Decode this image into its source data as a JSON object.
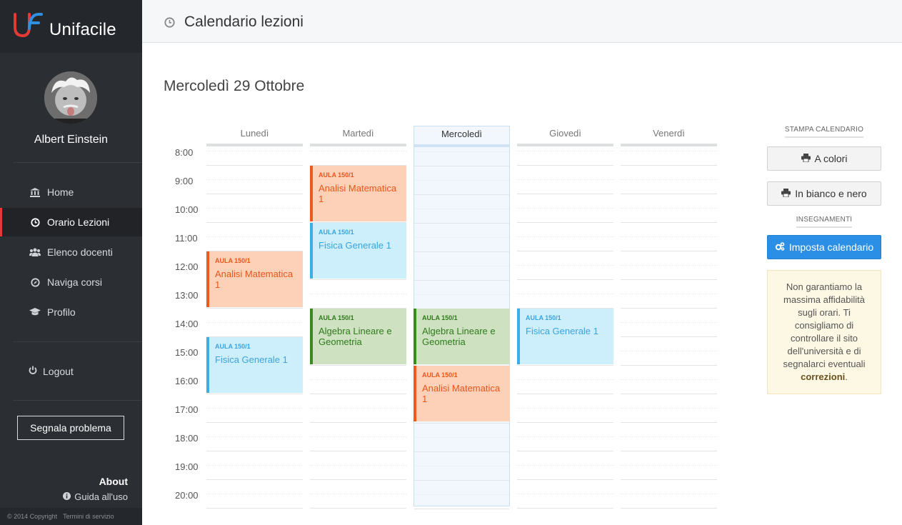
{
  "brand": {
    "name": "Unifacile"
  },
  "user": {
    "name": "Albert Einstein"
  },
  "nav": [
    {
      "label": "Home",
      "icon": "bank-icon"
    },
    {
      "label": "Orario Lezioni",
      "icon": "clock-icon",
      "active": true
    },
    {
      "label": "Elenco docenti",
      "icon": "users-icon"
    },
    {
      "label": "Naviga corsi",
      "icon": "compass-icon"
    },
    {
      "label": "Profilo",
      "icon": "graduation-cap-icon"
    }
  ],
  "logout_label": "Logout",
  "report_button": "Segnala problema",
  "about_label": "About",
  "guide_label": "Guida all'uso",
  "footer": {
    "copyright": "© 2014 Copyright",
    "terms": "Termini di servizio"
  },
  "header": {
    "title": "Calendario lezioni"
  },
  "date_title": "Mercoledì 29 Ottobre",
  "calendar": {
    "days": [
      "Lunedì",
      "Martedì",
      "Mercoledì",
      "Giovedì",
      "Venerdì"
    ],
    "today_index": 2,
    "hours": [
      "8:00",
      "9:00",
      "10:00",
      "11:00",
      "12:00",
      "13:00",
      "14:00",
      "15:00",
      "16:00",
      "17:00",
      "18:00",
      "19:00",
      "20:00"
    ],
    "events": [
      {
        "day": 0,
        "start": 11.5,
        "end": 13.5,
        "room": "AULA 150/1",
        "title": "Analisi Matematica 1",
        "color": "orange"
      },
      {
        "day": 0,
        "start": 14.5,
        "end": 16.5,
        "room": "AULA 150/1",
        "title": "Fisica Generale 1",
        "color": "blue"
      },
      {
        "day": 1,
        "start": 8.5,
        "end": 10.5,
        "room": "AULA 150/1",
        "title": "Analisi Matematica 1",
        "color": "orange"
      },
      {
        "day": 1,
        "start": 10.5,
        "end": 12.5,
        "room": "AULA 150/1",
        "title": "Fisica Generale 1",
        "color": "blue"
      },
      {
        "day": 1,
        "start": 13.5,
        "end": 15.5,
        "room": "AULA 150/1",
        "title": "Algebra Lineare e Geometria",
        "color": "green"
      },
      {
        "day": 2,
        "start": 13.5,
        "end": 15.5,
        "room": "AULA 150/1",
        "title": "Algebra Lineare e Geometria",
        "color": "green"
      },
      {
        "day": 2,
        "start": 15.5,
        "end": 17.5,
        "room": "AULA 150/1",
        "title": "Analisi Matematica 1",
        "color": "orange"
      },
      {
        "day": 3,
        "start": 13.5,
        "end": 15.5,
        "room": "AULA 150/1",
        "title": "Fisica Generale 1",
        "color": "blue"
      }
    ]
  },
  "panel": {
    "print_label": "STAMPA CALENDARIO",
    "color_button": "A colori",
    "bw_button": "In bianco e nero",
    "courses_label": "INSEGNAMENTI",
    "setup_button": "Imposta calendario",
    "notice_text": "Non garantiamo la massima affidabilità sugli orari. Ti consigliamo di controllare il sito dell'università e di segnalarci eventuali",
    "notice_bold": "correzioni",
    "notice_end": "."
  }
}
